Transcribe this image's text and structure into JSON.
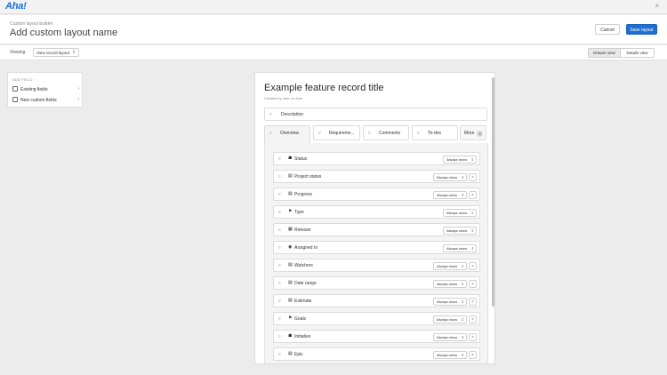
{
  "app": {
    "logo": "Aha!",
    "close": "×"
  },
  "header": {
    "breadcrumb": "Custom layout builder",
    "title": "Add custom layout name",
    "cancel": "Cancel",
    "save": "Save layout"
  },
  "subbar": {
    "viewing_label": "Viewing",
    "view_value": "View record layout",
    "drawer_view": "Drawer view",
    "details_view": "Details view"
  },
  "add_field": {
    "heading": "ADD FIELD",
    "items": [
      {
        "label": "Existing fields"
      },
      {
        "label": "New custom fields"
      }
    ]
  },
  "record": {
    "title": "Example feature record title",
    "subtitle": "Created by user on date",
    "description_label": "Description",
    "tabs": [
      {
        "label": "Overview"
      },
      {
        "label": "Requireme..."
      },
      {
        "label": "Comments"
      },
      {
        "label": "To-dos"
      }
    ],
    "more_label": "More",
    "more_count": "3",
    "fields": [
      {
        "icon": "☗",
        "icon_name": "status-icon",
        "label": "Status",
        "visibility": "Always show",
        "removable": false
      },
      {
        "icon": "▤",
        "icon_name": "list-icon",
        "label": "Project status",
        "visibility": "Always show",
        "removable": true
      },
      {
        "icon": "▤",
        "icon_name": "progress-icon",
        "label": "Progress",
        "visibility": "Always show",
        "removable": true
      },
      {
        "icon": "⚑",
        "icon_name": "flag-icon",
        "label": "Type",
        "visibility": "Always show",
        "removable": false
      },
      {
        "icon": "▦",
        "icon_name": "calendar-icon",
        "label": "Release",
        "visibility": "Always show",
        "removable": false
      },
      {
        "icon": "◉",
        "icon_name": "user-icon",
        "label": "Assigned to",
        "visibility": "Always show",
        "removable": false
      },
      {
        "icon": "▤",
        "icon_name": "watchers-icon",
        "label": "Watchers",
        "visibility": "Always show",
        "removable": true
      },
      {
        "icon": "▤",
        "icon_name": "date-range-icon",
        "label": "Date range",
        "visibility": "Always show",
        "removable": true
      },
      {
        "icon": "▤",
        "icon_name": "estimate-icon",
        "label": "Estimate",
        "visibility": "Always show",
        "removable": true
      },
      {
        "icon": "⚑",
        "icon_name": "goal-flag-icon",
        "label": "Goals",
        "visibility": "Always show",
        "removable": true
      },
      {
        "icon": "☗",
        "icon_name": "initiative-icon",
        "label": "Initiative",
        "visibility": "Always show",
        "removable": true
      },
      {
        "icon": "▤",
        "icon_name": "epic-icon",
        "label": "Epic",
        "visibility": "Always show",
        "removable": true
      }
    ]
  }
}
